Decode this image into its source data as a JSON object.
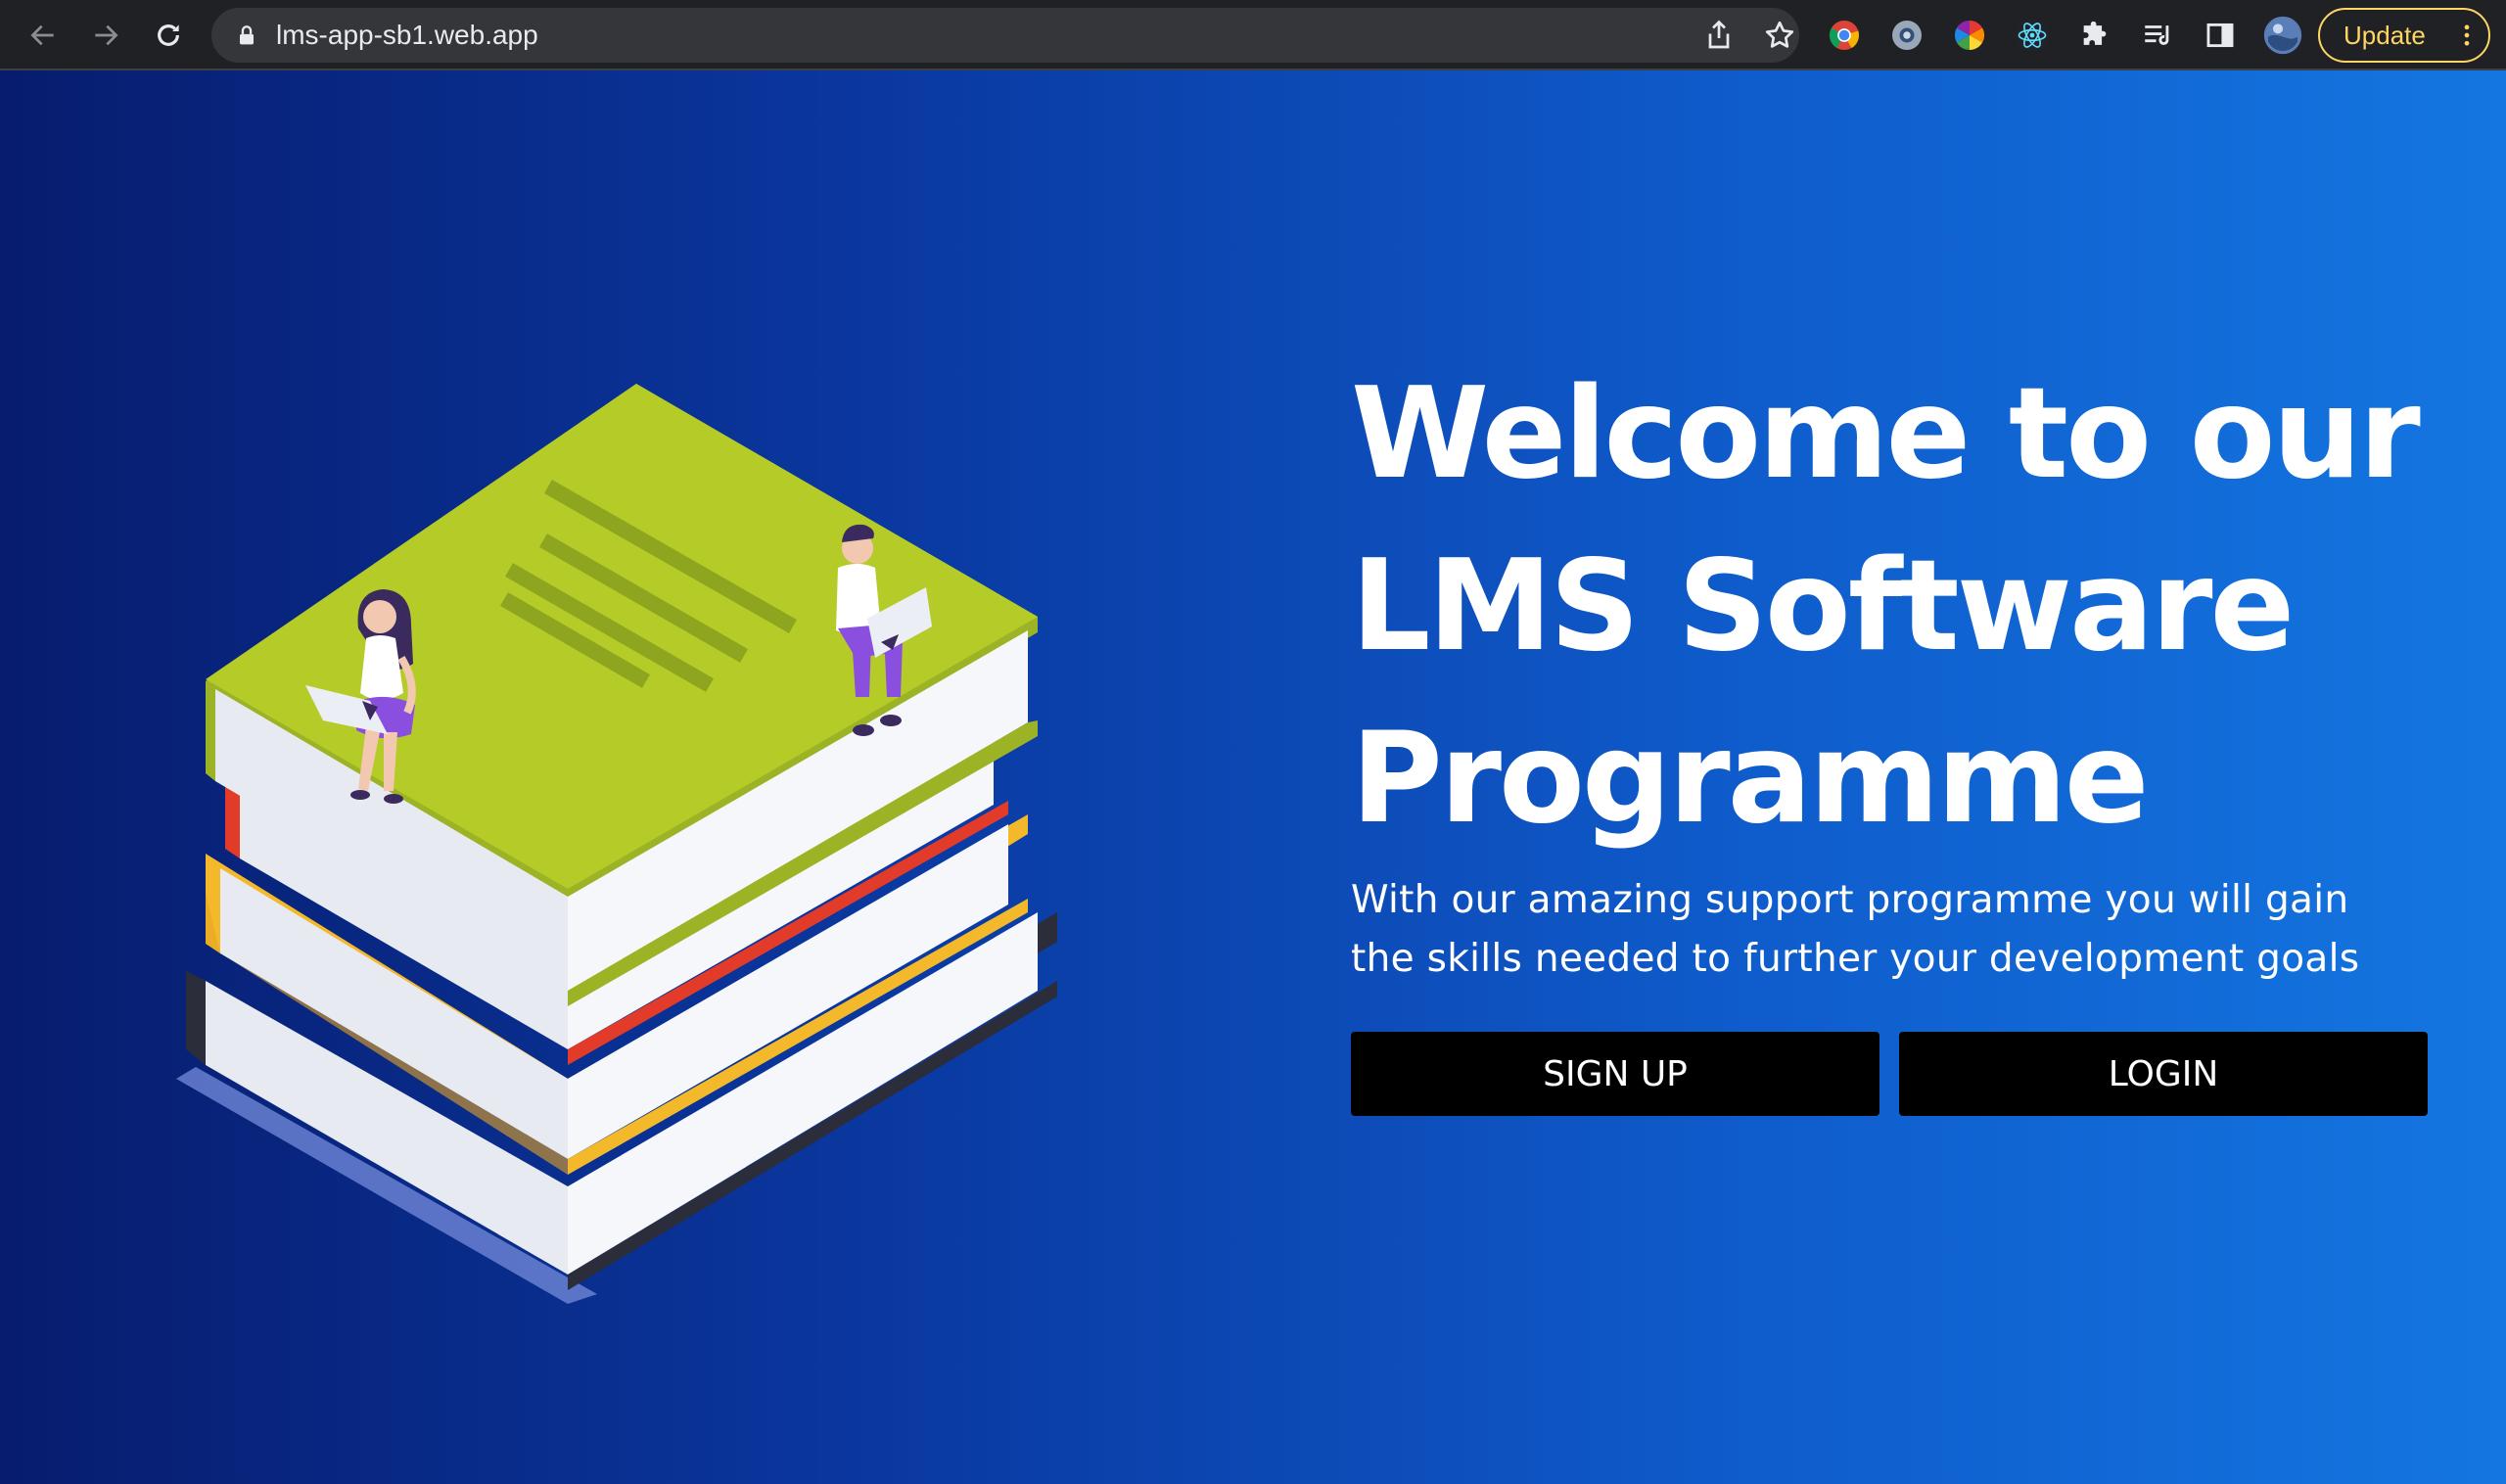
{
  "browser": {
    "url": "lms-app-sb1.web.app",
    "update_label": "Update"
  },
  "colors": {
    "toolbar_bg": "#202124",
    "omnibox_bg": "#35363a",
    "update_accent": "#fdd663",
    "page_gradient_start": "#071c6e",
    "page_gradient_end": "#1476e0",
    "button_bg": "#000000",
    "text": "#ffffff"
  },
  "hero": {
    "title_lines": [
      "Welcome to our",
      "LMS Software",
      "Programme"
    ],
    "subtitle": "With our amazing support programme you will gain the skills needed to further your development goals",
    "signup_label": "SIGN UP",
    "login_label": "LOGIN"
  },
  "icons": {
    "back": "arrow-left-icon",
    "forward": "arrow-right-icon",
    "reload": "reload-icon",
    "lock": "lock-icon",
    "share": "share-icon",
    "bookmark": "star-icon",
    "extensions": [
      "chrome-extension-icon",
      "circle-extension-icon",
      "color-wheel-extension-icon",
      "react-devtools-icon",
      "puzzle-icon",
      "media-queue-icon",
      "side-panel-icon",
      "profile-avatar-icon"
    ],
    "menu": "kebab-menu-icon"
  }
}
